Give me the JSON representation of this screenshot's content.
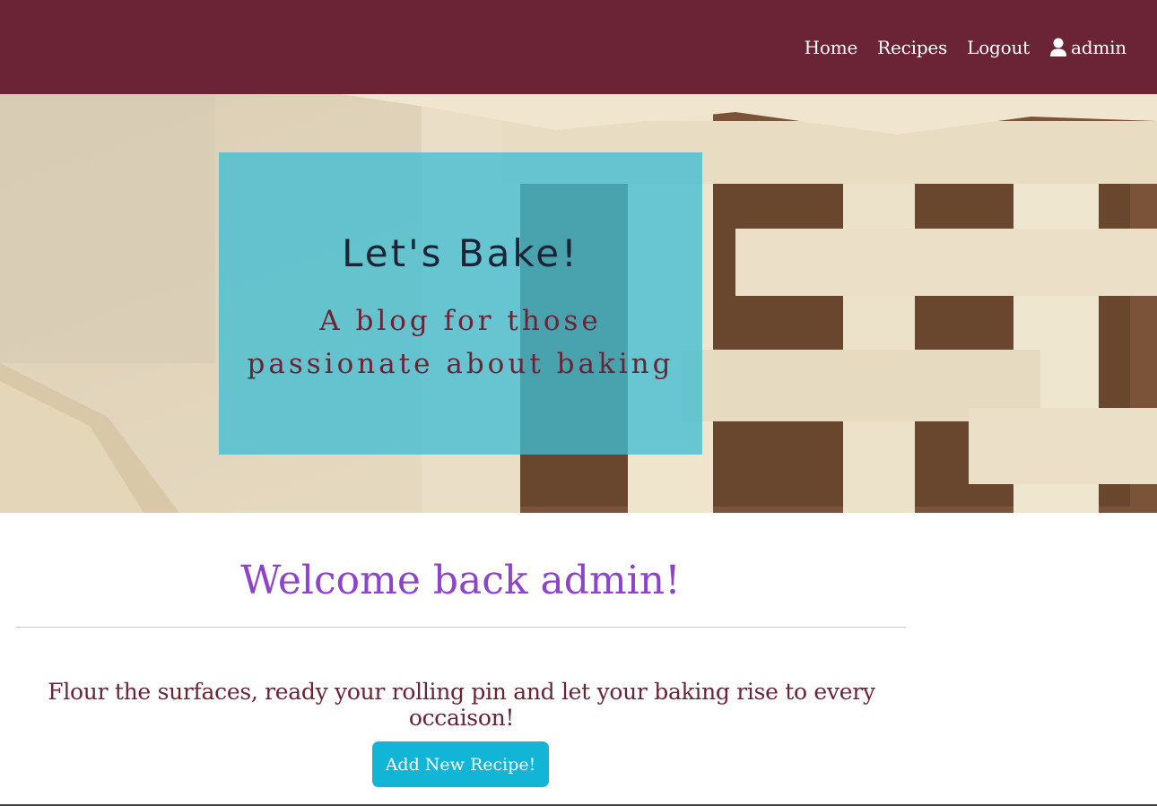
{
  "nav": {
    "links": [
      {
        "label": "Home"
      },
      {
        "label": "Recipes"
      },
      {
        "label": "Logout"
      }
    ],
    "user": {
      "icon": "user-icon",
      "label": "admin"
    }
  },
  "hero": {
    "title": "Let's Bake!",
    "subtitle_line1": "A blog for those",
    "subtitle_line2": "passionate about baking"
  },
  "main": {
    "welcome": "Welcome back admin!",
    "tagline": "Flour the surfaces, ready your rolling pin and let your baking rise to every occaison!",
    "add_button": "Add New Recipe!"
  },
  "colors": {
    "navbar": "#6b2436",
    "accent_teal": "#12b5d6",
    "welcome_purple": "#8e44c9",
    "text_maroon": "#6b2436"
  }
}
